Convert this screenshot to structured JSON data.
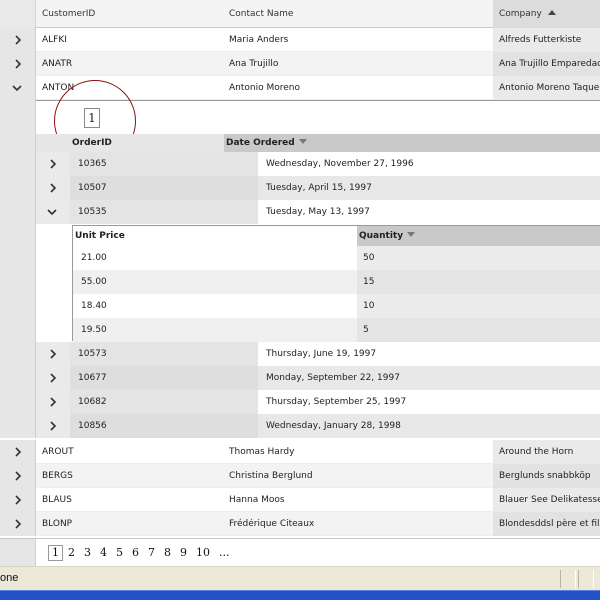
{
  "master": {
    "columns": [
      "CustomerID",
      "Contact Name",
      "Company"
    ],
    "rows_top": [
      {
        "id": "ALFKI",
        "contact": "Maria Anders",
        "company": "Alfreds Futterkiste"
      },
      {
        "id": "ANATR",
        "contact": "Ana Trujillo",
        "company": "Ana Trujillo Emparedados"
      },
      {
        "id": "ANTON",
        "contact": "Antonio Moreno",
        "company": "Antonio Moreno Taque"
      }
    ],
    "rows_bottom": [
      {
        "id": "AROUT",
        "contact": "Thomas Hardy",
        "company": "Around the Horn"
      },
      {
        "id": "BERGS",
        "contact": "Christina Berglund",
        "company": "Berglunds snabbköp"
      },
      {
        "id": "BLAUS",
        "contact": "Hanna Moos",
        "company": "Blauer See Delikatessen"
      },
      {
        "id": "BLONP",
        "contact": "Frédérique Citeaux",
        "company": "Blondesddsl père et fils"
      }
    ],
    "pager": [
      "1",
      "2",
      "3",
      "4",
      "5",
      "6",
      "7",
      "8",
      "9",
      "10",
      "..."
    ],
    "pager_selected": "1"
  },
  "orders": {
    "pager_page": "1",
    "columns": [
      "OrderID",
      "Date Ordered"
    ],
    "rows_before": [
      {
        "id": "10365",
        "date": "Wednesday, November 27, 1996"
      },
      {
        "id": "10507",
        "date": "Tuesday, April 15, 1997"
      },
      {
        "id": "10535",
        "date": "Tuesday, May 13, 1997"
      }
    ],
    "rows_after": [
      {
        "id": "10573",
        "date": "Thursday, June 19, 1997"
      },
      {
        "id": "10677",
        "date": "Monday, September 22, 1997"
      },
      {
        "id": "10682",
        "date": "Thursday, September 25, 1997"
      },
      {
        "id": "10856",
        "date": "Wednesday, January 28, 1998"
      }
    ]
  },
  "items": {
    "columns": [
      "Unit Price",
      "Quantity"
    ],
    "rows": [
      {
        "price": "21.00",
        "qty": "50"
      },
      {
        "price": "55.00",
        "qty": "15"
      },
      {
        "price": "18.40",
        "qty": "10"
      },
      {
        "price": "19.50",
        "qty": "5"
      }
    ]
  },
  "status": {
    "text": "one"
  },
  "colors": {
    "highlight_ring": "#8b1212",
    "taskbar": "#2450c8"
  }
}
